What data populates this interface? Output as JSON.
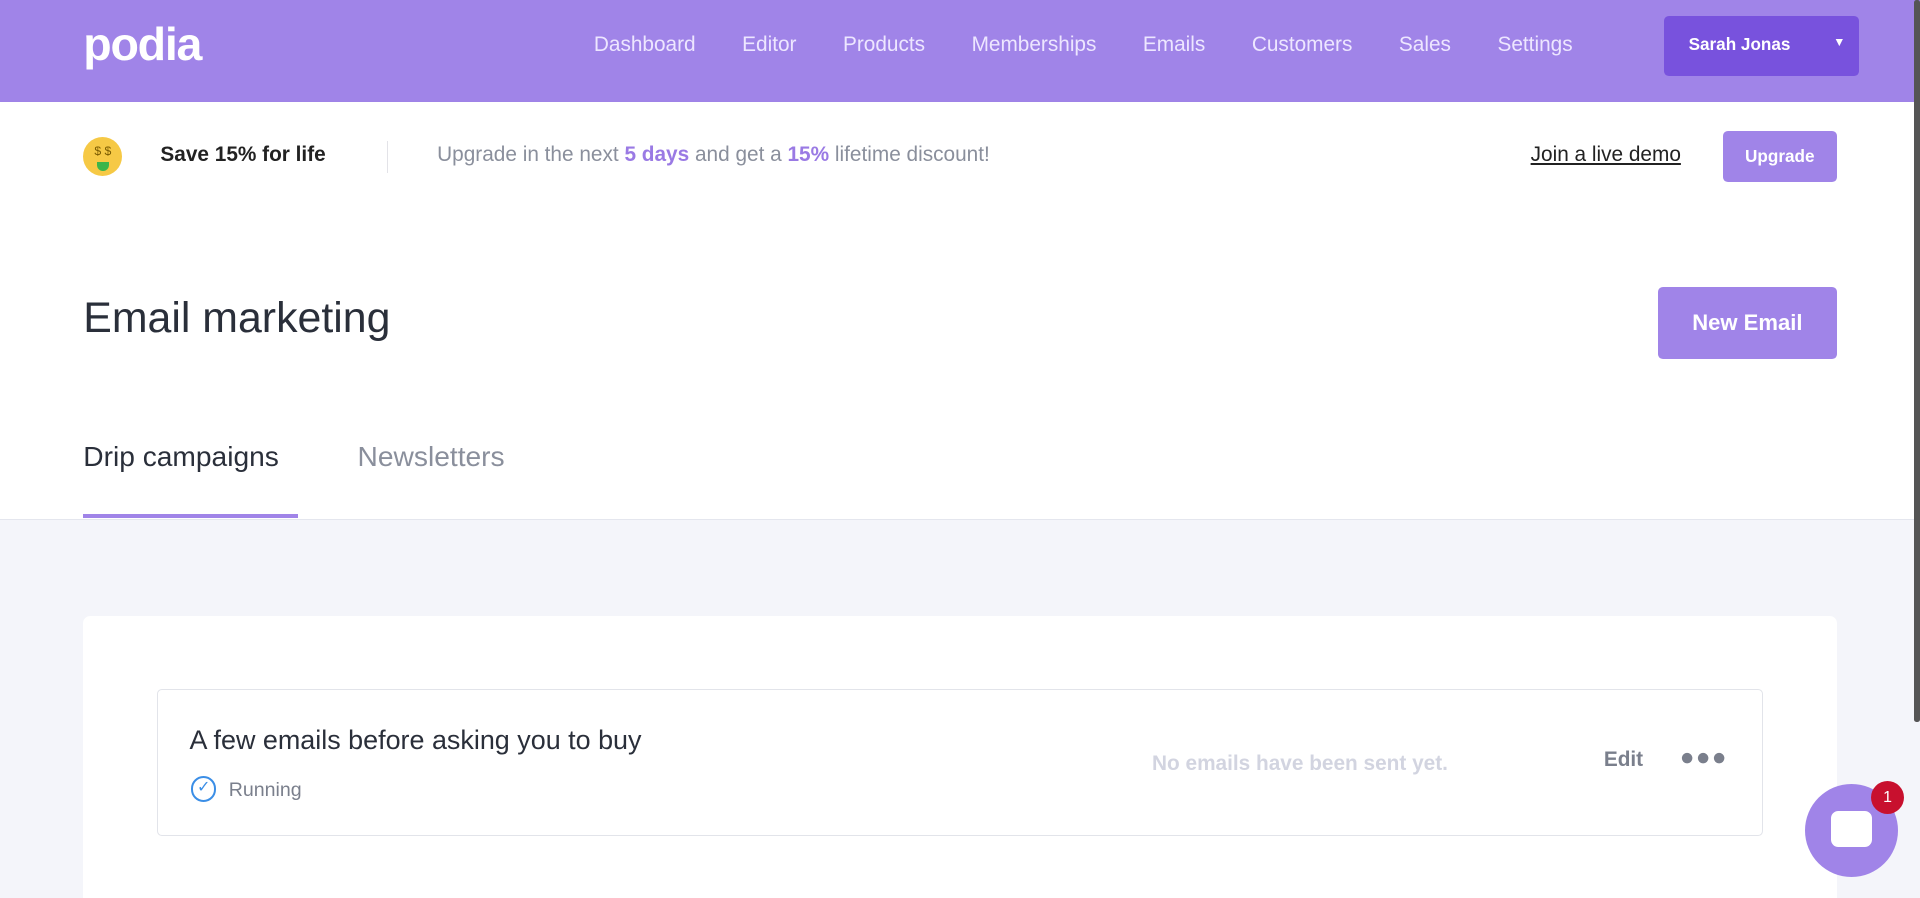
{
  "brand": {
    "logo": "podia",
    "accent": "#a084e8"
  },
  "nav": {
    "items": [
      "Dashboard",
      "Editor",
      "Products",
      "Memberships",
      "Emails",
      "Customers",
      "Sales",
      "Settings"
    ],
    "user": "Sarah Jonas"
  },
  "promo": {
    "title": "Save 15% for life",
    "msg_pre": "Upgrade in the next ",
    "days": "5 days",
    "msg_mid": " and get a ",
    "pct": "15%",
    "msg_post": " lifetime discount!",
    "demo": "Join a live demo",
    "upgrade": "Upgrade",
    "icon": "money-mouth-face-icon"
  },
  "page": {
    "title": "Email marketing",
    "new_email": "New Email",
    "tabs": [
      "Drip campaigns",
      "Newsletters"
    ]
  },
  "campaigns": [
    {
      "title": "A few emails before asking you to buy",
      "status": "Running",
      "sent": "No emails have been sent yet.",
      "edit": "Edit"
    }
  ],
  "chat": {
    "badge": "1"
  }
}
